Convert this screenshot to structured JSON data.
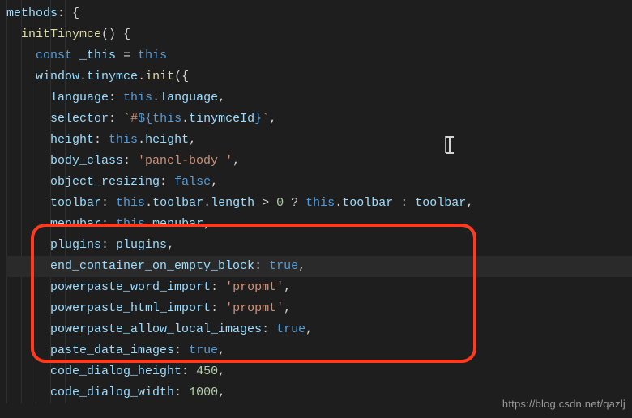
{
  "code": {
    "l1": {
      "methods": "methods",
      "colon": ": {"
    },
    "l2": {
      "fn": "initTinymce",
      "after": "() {"
    },
    "l3": {
      "const": "const",
      "name": "_this",
      "eq": " = ",
      "this": "this"
    },
    "l4": {
      "window": "window",
      "dot1": ".",
      "tinymce": "tinymce",
      "dot2": ".",
      "init": "init",
      "open": "({"
    },
    "l5": {
      "key": "language",
      "colon": ": ",
      "this": "this",
      "dot": ".",
      "val": "language",
      "comma": ","
    },
    "l6": {
      "key": "selector",
      "colon": ": ",
      "tick1": "`",
      "hash": "#",
      "dollar": "$",
      "brace1": "{",
      "this": "this",
      "dot": ".",
      "field": "tinymceId",
      "brace2": "}",
      "tick2": "`",
      "comma": ","
    },
    "l7": {
      "key": "height",
      "colon": ": ",
      "this": "this",
      "dot": ".",
      "val": "height",
      "comma": ","
    },
    "l8": {
      "key": "body_class",
      "colon": ": ",
      "str": "'panel-body '",
      "comma": ","
    },
    "l9": {
      "key": "object_resizing",
      "colon": ": ",
      "bool": "false",
      "comma": ","
    },
    "l10": {
      "key": "toolbar",
      "colon": ": ",
      "this1": "this",
      "dot1": ".",
      "toolbar": "toolbar",
      "dot2": ".",
      "length": "length",
      "gt": " > ",
      "zero": "0",
      "q": " ? ",
      "this2": "this",
      "dot3": ".",
      "t2": "toolbar",
      "colon2": " : ",
      "t3": "toolbar",
      "comma": ","
    },
    "l11": {
      "key": "menubar",
      "colon": ": ",
      "this": "this",
      "dot": ".",
      "val": "menubar",
      "comma": ","
    },
    "l12": {
      "key": "plugins",
      "colon": ": ",
      "val": "plugins",
      "comma": ","
    },
    "l13": {
      "key": "end_container_on_empty_block",
      "colon": ": ",
      "bool": "true",
      "comma": ","
    },
    "l14": {
      "key": "powerpaste_word_import",
      "colon": ": ",
      "str": "'propmt'",
      "comma": ","
    },
    "l15": {
      "key": "powerpaste_html_import",
      "colon": ": ",
      "str": "'propmt'",
      "comma": ","
    },
    "l16": {
      "key": "powerpaste_allow_local_images",
      "colon": ": ",
      "bool": "true",
      "comma": ","
    },
    "l17": {
      "key": "paste_data_images",
      "colon": ": ",
      "bool": "true",
      "comma": ","
    },
    "l18": {
      "blank": ""
    },
    "l19": {
      "key": "code_dialog_height",
      "colon": ": ",
      "num": "450",
      "comma": ","
    },
    "l20": {
      "key": "code_dialog_width",
      "colon": ": ",
      "num": "1000",
      "comma": ","
    }
  },
  "watermark": "https://blog.csdn.net/qazlj"
}
